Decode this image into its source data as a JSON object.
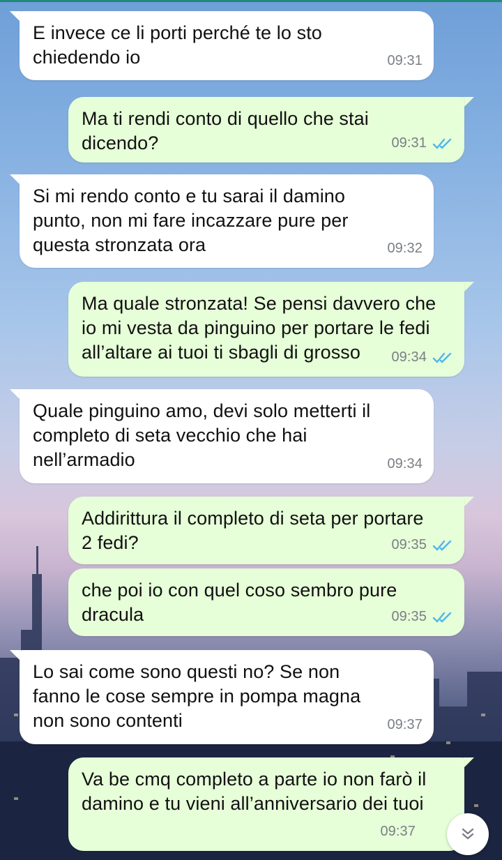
{
  "messages": [
    {
      "direction": "in",
      "text": "E invece ce li porti perché te lo sto\nchiedendo io",
      "time": "09:31"
    },
    {
      "direction": "out",
      "text": "Ma ti rendi conto di quello che stai\ndicendo?",
      "time": "09:31",
      "status": "read"
    },
    {
      "direction": "in",
      "text": "Si mi rendo conto e tu sarai il damino\npunto, non mi fare incazzare pure per\nquesta stronzata ora",
      "time": "09:32"
    },
    {
      "direction": "out",
      "text": "Ma quale stronzata! Se pensi davvero che\nio mi vesta da pinguino per portare le fedi\nall’altare ai tuoi ti sbagli di grosso",
      "time": "09:34",
      "status": "read"
    },
    {
      "direction": "in",
      "text": "Quale pinguino amo, devi solo metterti il\ncompleto di seta vecchio che hai\nnell’armadio",
      "time": "09:34"
    },
    {
      "direction": "out",
      "text": "Addirittura il completo di seta per portare\n2 fedi?",
      "time": "09:35",
      "status": "read"
    },
    {
      "direction": "out",
      "text": "che poi io con quel coso sembro pure\ndracula",
      "time": "09:35",
      "status": "read"
    },
    {
      "direction": "in",
      "text": "Lo sai come sono questi no? Se non\nfanno le cose sempre in pompa magna\nnon sono contenti",
      "time": "09:37"
    },
    {
      "direction": "out",
      "text": "Va be cmq completo a parte io non farò il\ndamino e tu vieni all’anniversario dei tuoi",
      "time": "09:37",
      "status": "read"
    }
  ],
  "colors": {
    "incoming_bubble": "#ffffff",
    "outgoing_bubble": "#e6ffd8",
    "read_ticks": "#4fb6ec",
    "time_text": "#7a7f84"
  },
  "icons": {
    "read_status": "double-check-icon",
    "scroll_down": "chevron-double-down-icon"
  }
}
